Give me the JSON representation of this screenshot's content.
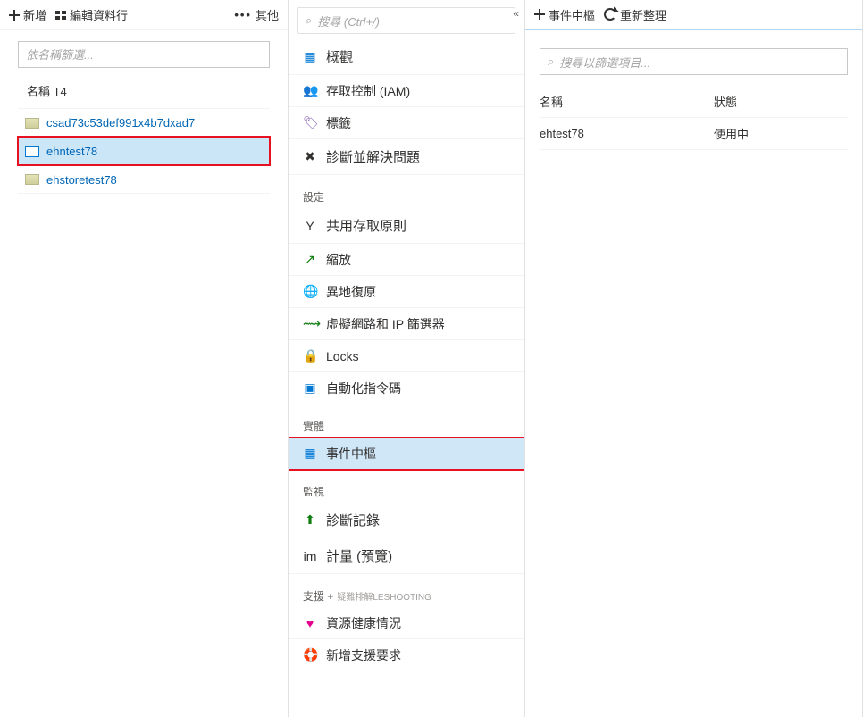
{
  "left": {
    "toolbar": {
      "add": "新增",
      "edit_columns": "編輯資料行",
      "more": "其他"
    },
    "filter_placeholder": "依名稱篩選...",
    "column_header": "名稱 T4",
    "items": [
      {
        "label": "csad73c53def991x4b7dxad7",
        "iconType": "storage",
        "selected": false
      },
      {
        "label": "ehntest78",
        "iconType": "eh",
        "selected": true
      },
      {
        "label": "ehstoretest78",
        "iconType": "storage",
        "selected": false
      }
    ]
  },
  "mid": {
    "search_placeholder": "搜尋 (Ctrl+/)",
    "overview": "概觀",
    "iam": "存取控制 (IAM)",
    "tags": "標籤",
    "diagnose": "診斷並解決問題",
    "group_settings": "設定",
    "shared_access": "共用存取原則",
    "scale": "縮放",
    "geo": "異地復原",
    "vnet": "虛擬網路和 IP 篩選器",
    "locks": "Locks",
    "automation": "自動化指令碼",
    "group_entities": "實體",
    "event_hubs": "事件中樞",
    "group_monitor": "監視",
    "diag_logs": "診斷記錄",
    "metrics": "計量 (預覽)",
    "group_support": "支援 +",
    "group_support_sub": "疑難排解LESHOOTING",
    "resource_health": "資源健康情況",
    "support_request": "新增支援要求"
  },
  "right": {
    "toolbar": {
      "event_hub": "事件中樞",
      "refresh": "重新整理"
    },
    "filter_placeholder": "搜尋以篩選項目...",
    "col_name": "名稱",
    "col_status": "狀態",
    "rows": [
      {
        "name": "ehtest78",
        "status": "使用中"
      }
    ]
  }
}
